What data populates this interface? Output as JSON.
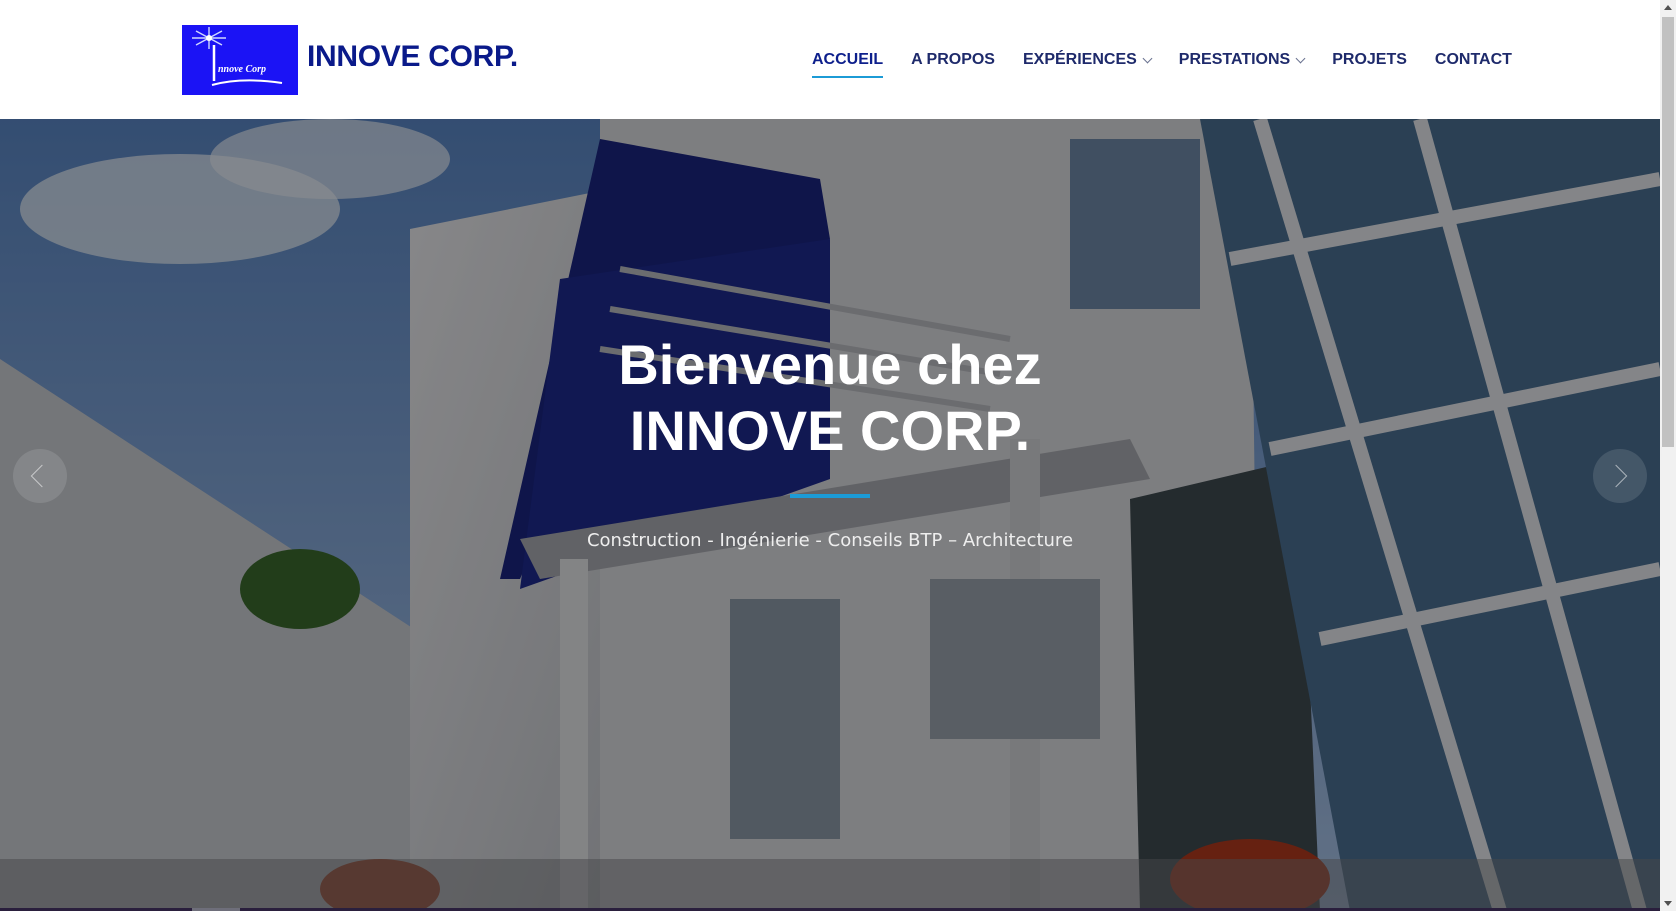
{
  "header": {
    "brand_name": "INNOVE CORP.",
    "logo_text": "nnove Corp",
    "nav": [
      {
        "label": "ACCUEIL",
        "active": true,
        "has_dropdown": false
      },
      {
        "label": "A PROPOS",
        "active": false,
        "has_dropdown": false
      },
      {
        "label": "EXPÉRIENCES",
        "active": false,
        "has_dropdown": true
      },
      {
        "label": "PRESTATIONS",
        "active": false,
        "has_dropdown": true
      },
      {
        "label": "PROJETS",
        "active": false,
        "has_dropdown": false
      },
      {
        "label": "CONTACT",
        "active": false,
        "has_dropdown": false
      }
    ]
  },
  "hero": {
    "title_line1": "Bienvenue chez",
    "title_line2": "INNOVE CORP.",
    "subtitle": "Construction - Ingénierie - Conseils BTP – Architecture",
    "prev_icon": "chevron-left-icon",
    "next_icon": "chevron-right-icon"
  },
  "colors": {
    "brand_text": "#0a1a8a",
    "nav_text": "#1e2a6b",
    "accent": "#1c9bd6",
    "logo_bg": "#1b13f5"
  }
}
